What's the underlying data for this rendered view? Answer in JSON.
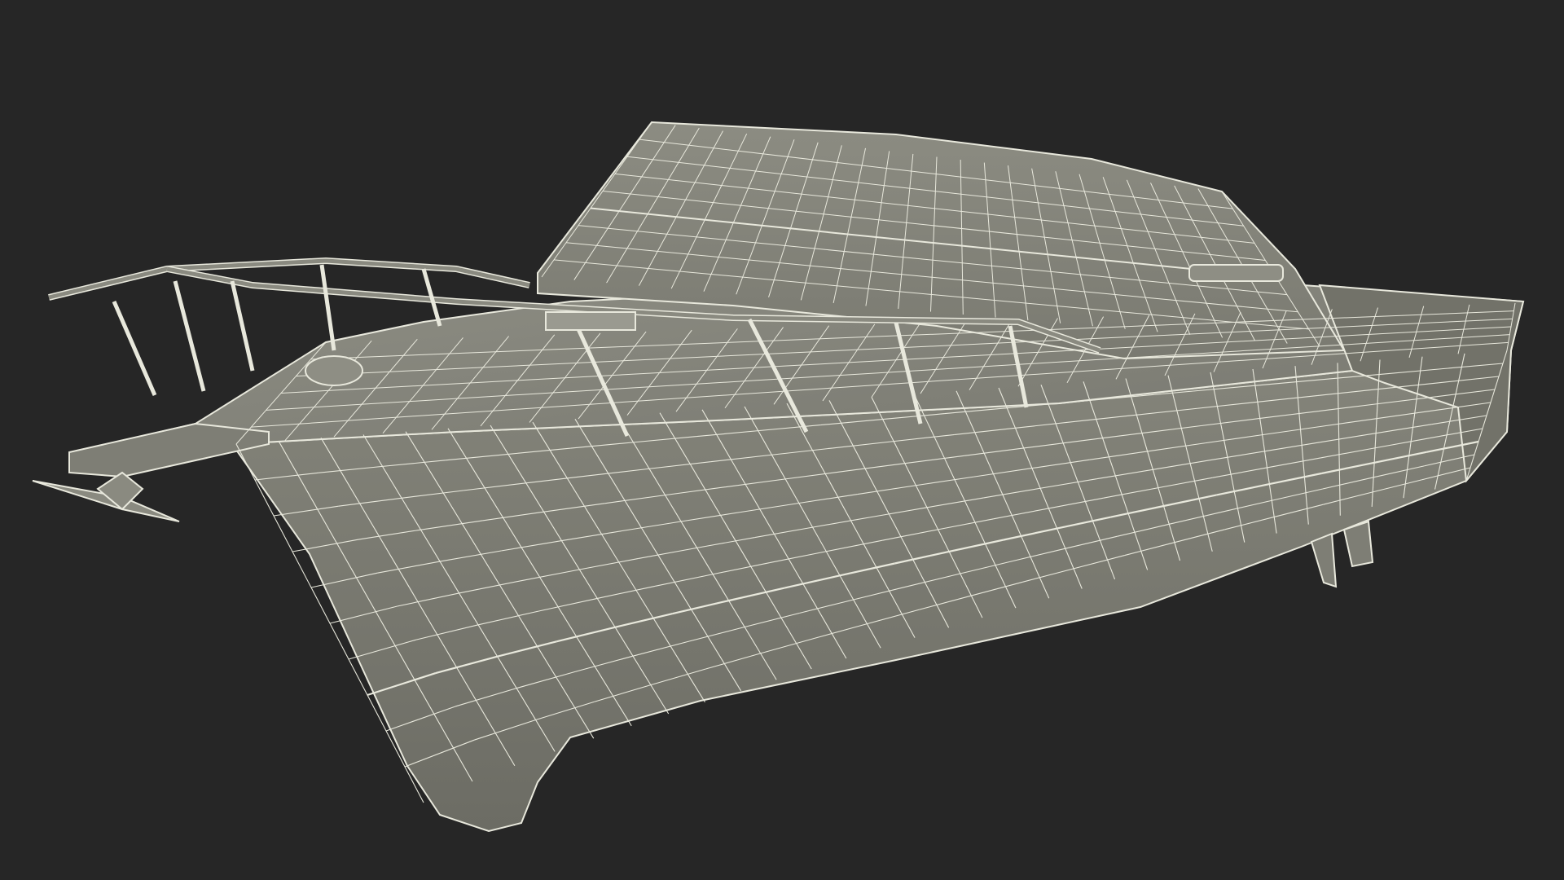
{
  "scene": {
    "subject": "boat-wireframe-model",
    "colors": {
      "background": "#262626",
      "surface_light": "#8a8a80",
      "surface_mid": "#7a7a71",
      "surface_dark": "#5e5e57",
      "wire": "#e8e8dc",
      "rail": "#9a9a90"
    }
  }
}
